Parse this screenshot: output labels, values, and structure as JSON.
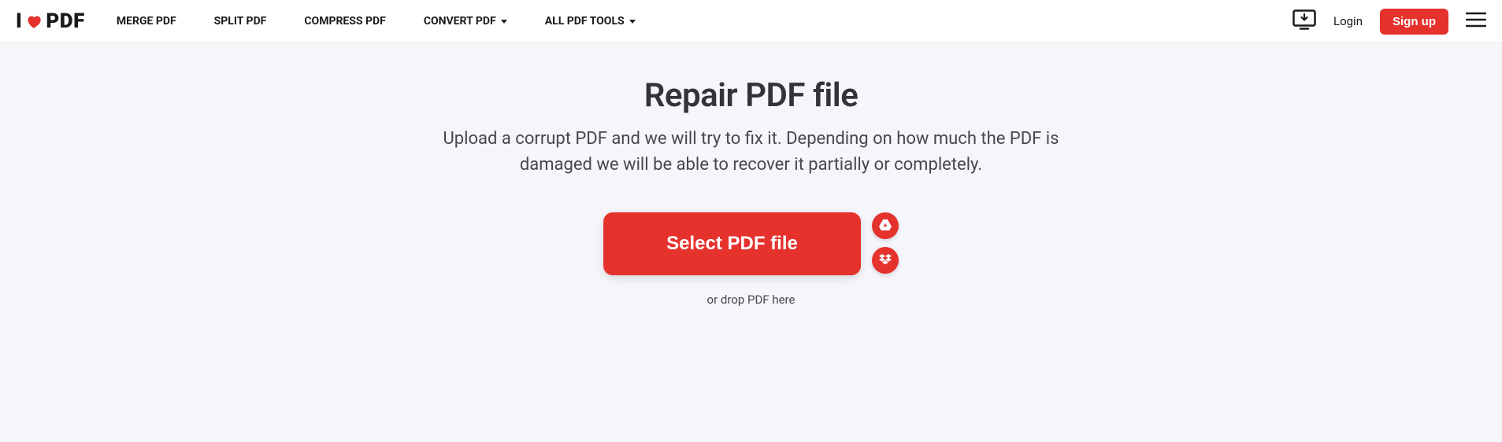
{
  "logo": {
    "prefix": "I",
    "suffix": "PDF"
  },
  "nav": {
    "merge": "MERGE PDF",
    "split": "SPLIT PDF",
    "compress": "COMPRESS PDF",
    "convert": "CONVERT PDF",
    "all_tools": "ALL PDF TOOLS"
  },
  "header_right": {
    "login": "Login",
    "signup": "Sign up"
  },
  "main": {
    "title": "Repair PDF file",
    "subtitle": "Upload a corrupt PDF and we will try to fix it. Depending on how much the PDF is damaged we will be able to recover it partially or completely.",
    "select_button": "Select PDF file",
    "drop_hint": "or drop PDF here"
  }
}
